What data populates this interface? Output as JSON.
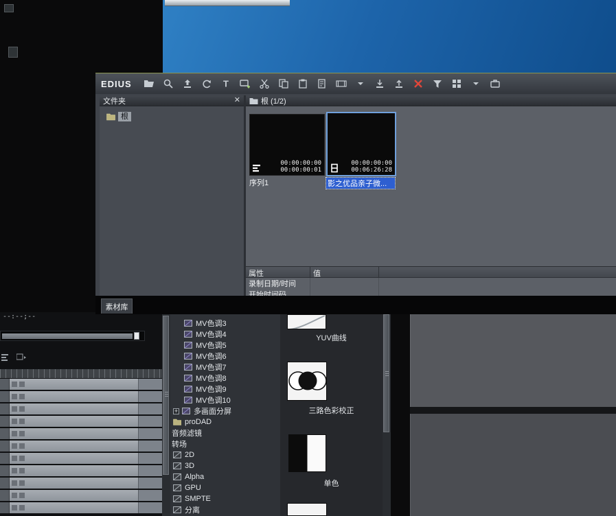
{
  "bin_window": {
    "title": "EDIUS",
    "toolbar_icons": [
      "open-folder",
      "search",
      "folder-up",
      "refresh",
      "title",
      "capture",
      "cut",
      "copy",
      "paste",
      "duplicate",
      "sequence",
      "dropdown",
      "import",
      "export",
      "delete",
      "filter",
      "view-grid",
      "dropdown2",
      "bin-case"
    ],
    "folders_panel": {
      "header": "文件夹",
      "close_label": "✕",
      "root_label": "根"
    },
    "contents_pane": {
      "header": "根 (1/2)"
    },
    "clips": [
      {
        "label": "序列1",
        "timecode_top": "00:00:00:00",
        "timecode_bottom": "00:00:00:01",
        "icon": "sequence-clip",
        "selected": false
      },
      {
        "label": "影之优品亲子微...",
        "timecode_top": "00:00:00:00",
        "timecode_bottom": "00:06:26:28",
        "icon": "film-clip",
        "selected": true
      }
    ],
    "properties": {
      "columns": [
        "属性",
        "值"
      ],
      "rows": [
        {
          "property": "录制日期/时间",
          "value": ""
        },
        {
          "property": "开始时间码",
          "value": ""
        }
      ]
    },
    "bottom_tab": "素材库",
    "selection_color": "#2e5fd0"
  },
  "main_app": {
    "timeline": {
      "time_display": "--:--;--",
      "track_count": 11
    },
    "effects_tree": [
      {
        "label": "MV色调3",
        "icon": "filter",
        "indent": 2
      },
      {
        "label": "MV色调4",
        "icon": "filter",
        "indent": 2
      },
      {
        "label": "MV色调5",
        "icon": "filter",
        "indent": 2
      },
      {
        "label": "MV色调6",
        "icon": "filter",
        "indent": 2
      },
      {
        "label": "MV色调7",
        "icon": "filter",
        "indent": 2
      },
      {
        "label": "MV色调8",
        "icon": "filter",
        "indent": 2
      },
      {
        "label": "MV色调9",
        "icon": "filter",
        "indent": 2
      },
      {
        "label": "MV色调10",
        "icon": "filter",
        "indent": 2
      },
      {
        "label": "多画面分屏",
        "icon": "filter",
        "indent": 2,
        "expander": "+"
      },
      {
        "label": "proDAD",
        "icon": "folder",
        "indent": 1
      },
      {
        "label": "音频滤镜",
        "indent": 1
      },
      {
        "label": "转场",
        "indent": 1
      },
      {
        "label": "2D",
        "icon": "transition",
        "indent": 1
      },
      {
        "label": "3D",
        "icon": "transition",
        "indent": 1
      },
      {
        "label": "Alpha",
        "icon": "transition",
        "indent": 1
      },
      {
        "label": "GPU",
        "icon": "transition",
        "indent": 1
      },
      {
        "label": "SMPTE",
        "icon": "transition",
        "indent": 1
      },
      {
        "label": "分离",
        "icon": "transition",
        "indent": 1
      }
    ],
    "effects_thumbnails": [
      {
        "label": "YUV曲线",
        "shape": "curve"
      },
      {
        "label": "三路色彩校正",
        "shape": "circles"
      },
      {
        "label": "单色",
        "shape": "mono"
      },
      {
        "label": "",
        "shape": "blank"
      }
    ]
  }
}
